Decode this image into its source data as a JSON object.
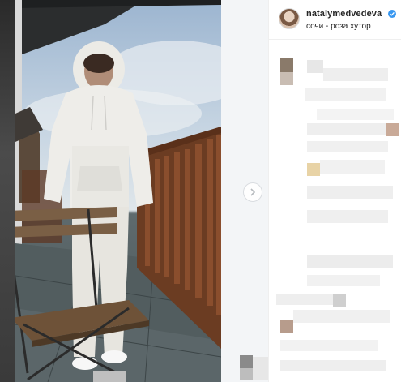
{
  "post": {
    "username": "natalymedvedeva",
    "location": "сочи - роза хутор",
    "verified": true
  },
  "icons": {
    "avatar": "avatar",
    "verified": "verified-badge-icon",
    "next": "chevron-right-icon"
  },
  "colors": {
    "verified_blue": "#3897f0",
    "text": "#262626",
    "border": "#efefef"
  },
  "comments": {
    "state": "pixelated"
  }
}
